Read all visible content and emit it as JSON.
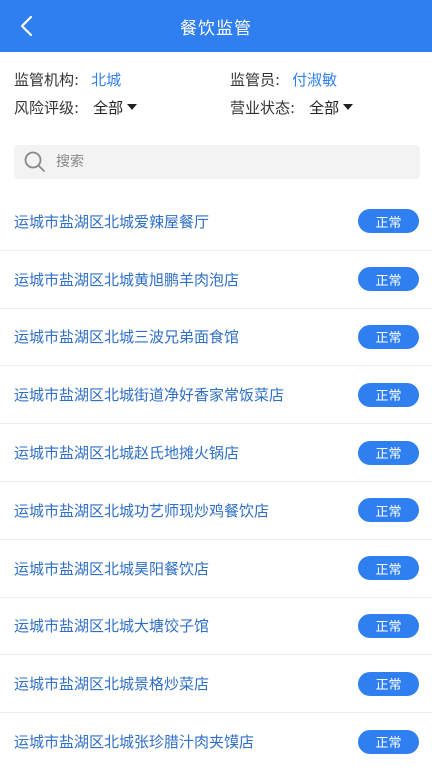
{
  "header": {
    "title": "餐饮监管",
    "back_icon": "chevron-left-icon"
  },
  "filters": {
    "agency_label": "监管机构:",
    "agency_value": "北城",
    "supervisor_label": "监管员:",
    "supervisor_value": "付淑敏",
    "risk_label": "风险评级:",
    "risk_value": "全部",
    "business_label": "营业状态:",
    "business_value": "全部"
  },
  "search": {
    "placeholder": "搜索",
    "value": ""
  },
  "colors": {
    "accent": "#2F7FF0",
    "link_text": "#2F6FC8"
  },
  "items": [
    {
      "name": "运城市盐湖区北城爱辣屋餐厅",
      "status": "正常"
    },
    {
      "name": "运城市盐湖区北城黄旭鹏羊肉泡店",
      "status": "正常"
    },
    {
      "name": "运城市盐湖区北城三波兄弟面食馆",
      "status": "正常"
    },
    {
      "name": "运城市盐湖区北城街道净好香家常饭菜店",
      "status": "正常"
    },
    {
      "name": "运城市盐湖区北城赵氏地摊火锅店",
      "status": "正常"
    },
    {
      "name": "运城市盐湖区北城功艺师现炒鸡餐饮店",
      "status": "正常"
    },
    {
      "name": "运城市盐湖区北城昊阳餐饮店",
      "status": "正常"
    },
    {
      "name": "运城市盐湖区北城大塘饺子馆",
      "status": "正常"
    },
    {
      "name": "运城市盐湖区北城景格炒菜店",
      "status": "正常"
    },
    {
      "name": "运城市盐湖区北城张珍腊汁肉夹馍店",
      "status": "正常"
    }
  ]
}
